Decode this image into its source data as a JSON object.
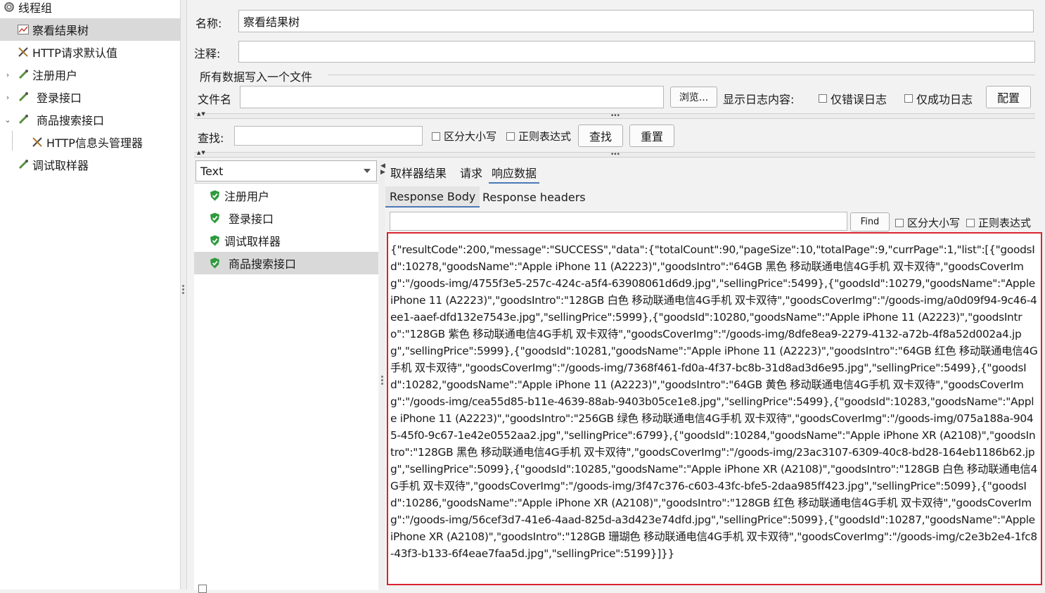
{
  "tree": {
    "items": [
      {
        "label": "线程组",
        "icon": "gear-icon"
      },
      {
        "label": "察看结果树",
        "icon": "chart-icon"
      },
      {
        "label": "HTTP请求默认值",
        "icon": "wrench-icon"
      },
      {
        "label": "注册用户",
        "icon": "pipette-icon"
      },
      {
        "label": "登录接口",
        "icon": "pipette-icon"
      },
      {
        "label": "商品搜索接口",
        "icon": "pipette-icon"
      },
      {
        "label": "HTTP信息头管理器",
        "icon": "wrench-icon"
      },
      {
        "label": "调试取样器",
        "icon": "pipette-icon"
      }
    ]
  },
  "config": {
    "name_label": "名称:",
    "name_value": "察看结果树",
    "comment_label": "注释:",
    "comment_value": "",
    "file_section_title": "所有数据写入一个文件",
    "filename_label": "文件名",
    "filename_value": "",
    "browse_button": "浏览...",
    "log_display_label": "显示日志内容:",
    "errors_only_label": "仅错误日志",
    "success_only_label": "仅成功日志",
    "configure_button": "配置"
  },
  "search": {
    "label": "查找:",
    "value": "",
    "case_sensitive_label": "区分大小写",
    "regex_label": "正则表达式",
    "find_button": "查找",
    "reset_button": "重置"
  },
  "results": {
    "renderer": "Text",
    "items": [
      {
        "label": "注册用户",
        "status": "success"
      },
      {
        "label": "登录接口",
        "status": "success"
      },
      {
        "label": "调试取样器",
        "status": "success"
      },
      {
        "label": "商品搜索接口",
        "status": "success"
      }
    ],
    "tabs": [
      "取样器结果",
      "请求",
      "响应数据"
    ],
    "active_tab": "响应数据",
    "subtabs": [
      "Response Body",
      "Response headers"
    ],
    "active_subtab": "Response Body",
    "body_search": {
      "value": "",
      "find_button": "Find",
      "case_sensitive_label": "区分大小写",
      "regex_label": "正则表达式"
    },
    "response_body": "{\"resultCode\":200,\"message\":\"SUCCESS\",\"data\":{\"totalCount\":90,\"pageSize\":10,\"totalPage\":9,\"currPage\":1,\"list\":[{\"goodsId\":10278,\"goodsName\":\"Apple iPhone 11 (A2223)\",\"goodsIntro\":\"64GB 黑色 移动联通电信4G手机 双卡双待\",\"goodsCoverImg\":\"/goods-img/4755f3e5-257c-424c-a5f4-63908061d6d9.jpg\",\"sellingPrice\":5499},{\"goodsId\":10279,\"goodsName\":\"Apple iPhone 11 (A2223)\",\"goodsIntro\":\"128GB 白色 移动联通电信4G手机 双卡双待\",\"goodsCoverImg\":\"/goods-img/a0d09f94-9c46-4ee1-aaef-dfd132e7543e.jpg\",\"sellingPrice\":5999},{\"goodsId\":10280,\"goodsName\":\"Apple iPhone 11 (A2223)\",\"goodsIntro\":\"128GB 紫色 移动联通电信4G手机 双卡双待\",\"goodsCoverImg\":\"/goods-img/8dfe8ea9-2279-4132-a72b-4f8a52d002a4.jpg\",\"sellingPrice\":5999},{\"goodsId\":10281,\"goodsName\":\"Apple iPhone 11 (A2223)\",\"goodsIntro\":\"64GB 红色 移动联通电信4G手机 双卡双待\",\"goodsCoverImg\":\"/goods-img/7368f461-fd0a-4f37-bc8b-31d8ad3d6e95.jpg\",\"sellingPrice\":5499},{\"goodsId\":10282,\"goodsName\":\"Apple iPhone 11 (A2223)\",\"goodsIntro\":\"64GB 黄色 移动联通电信4G手机 双卡双待\",\"goodsCoverImg\":\"/goods-img/cea55d85-b11e-4639-88ab-9403b05ce1e8.jpg\",\"sellingPrice\":5499},{\"goodsId\":10283,\"goodsName\":\"Apple iPhone 11 (A2223)\",\"goodsIntro\":\"256GB 绿色 移动联通电信4G手机 双卡双待\",\"goodsCoverImg\":\"/goods-img/075a188a-9045-45f0-9c67-1e42e0552aa2.jpg\",\"sellingPrice\":6799},{\"goodsId\":10284,\"goodsName\":\"Apple iPhone XR (A2108)\",\"goodsIntro\":\"128GB 黑色 移动联通电信4G手机 双卡双待\",\"goodsCoverImg\":\"/goods-img/23ac3107-6309-40c8-bd28-164eb1186b62.jpg\",\"sellingPrice\":5099},{\"goodsId\":10285,\"goodsName\":\"Apple iPhone XR (A2108)\",\"goodsIntro\":\"128GB 白色 移动联通电信4G手机 双卡双待\",\"goodsCoverImg\":\"/goods-img/3f47c376-c603-43fc-bfe5-2daa985ff423.jpg\",\"sellingPrice\":5099},{\"goodsId\":10286,\"goodsName\":\"Apple iPhone XR (A2108)\",\"goodsIntro\":\"128GB 红色 移动联通电信4G手机 双卡双待\",\"goodsCoverImg\":\"/goods-img/56cef3d7-41e6-4aad-825d-a3d423e74dfd.jpg\",\"sellingPrice\":5099},{\"goodsId\":10287,\"goodsName\":\"Apple iPhone XR (A2108)\",\"goodsIntro\":\"128GB 珊瑚色 移动联通电信4G手机 双卡双待\",\"goodsCoverImg\":\"/goods-img/c2e3b2e4-1fc8-43f3-b133-6f4eae7faa5d.jpg\",\"sellingPrice\":5199}]}}"
  },
  "colors": {
    "success_green": "#2e9a3c",
    "highlight_border": "#d9232e",
    "tab_accent": "#4a78b5",
    "selection": "#d9d9d9"
  }
}
